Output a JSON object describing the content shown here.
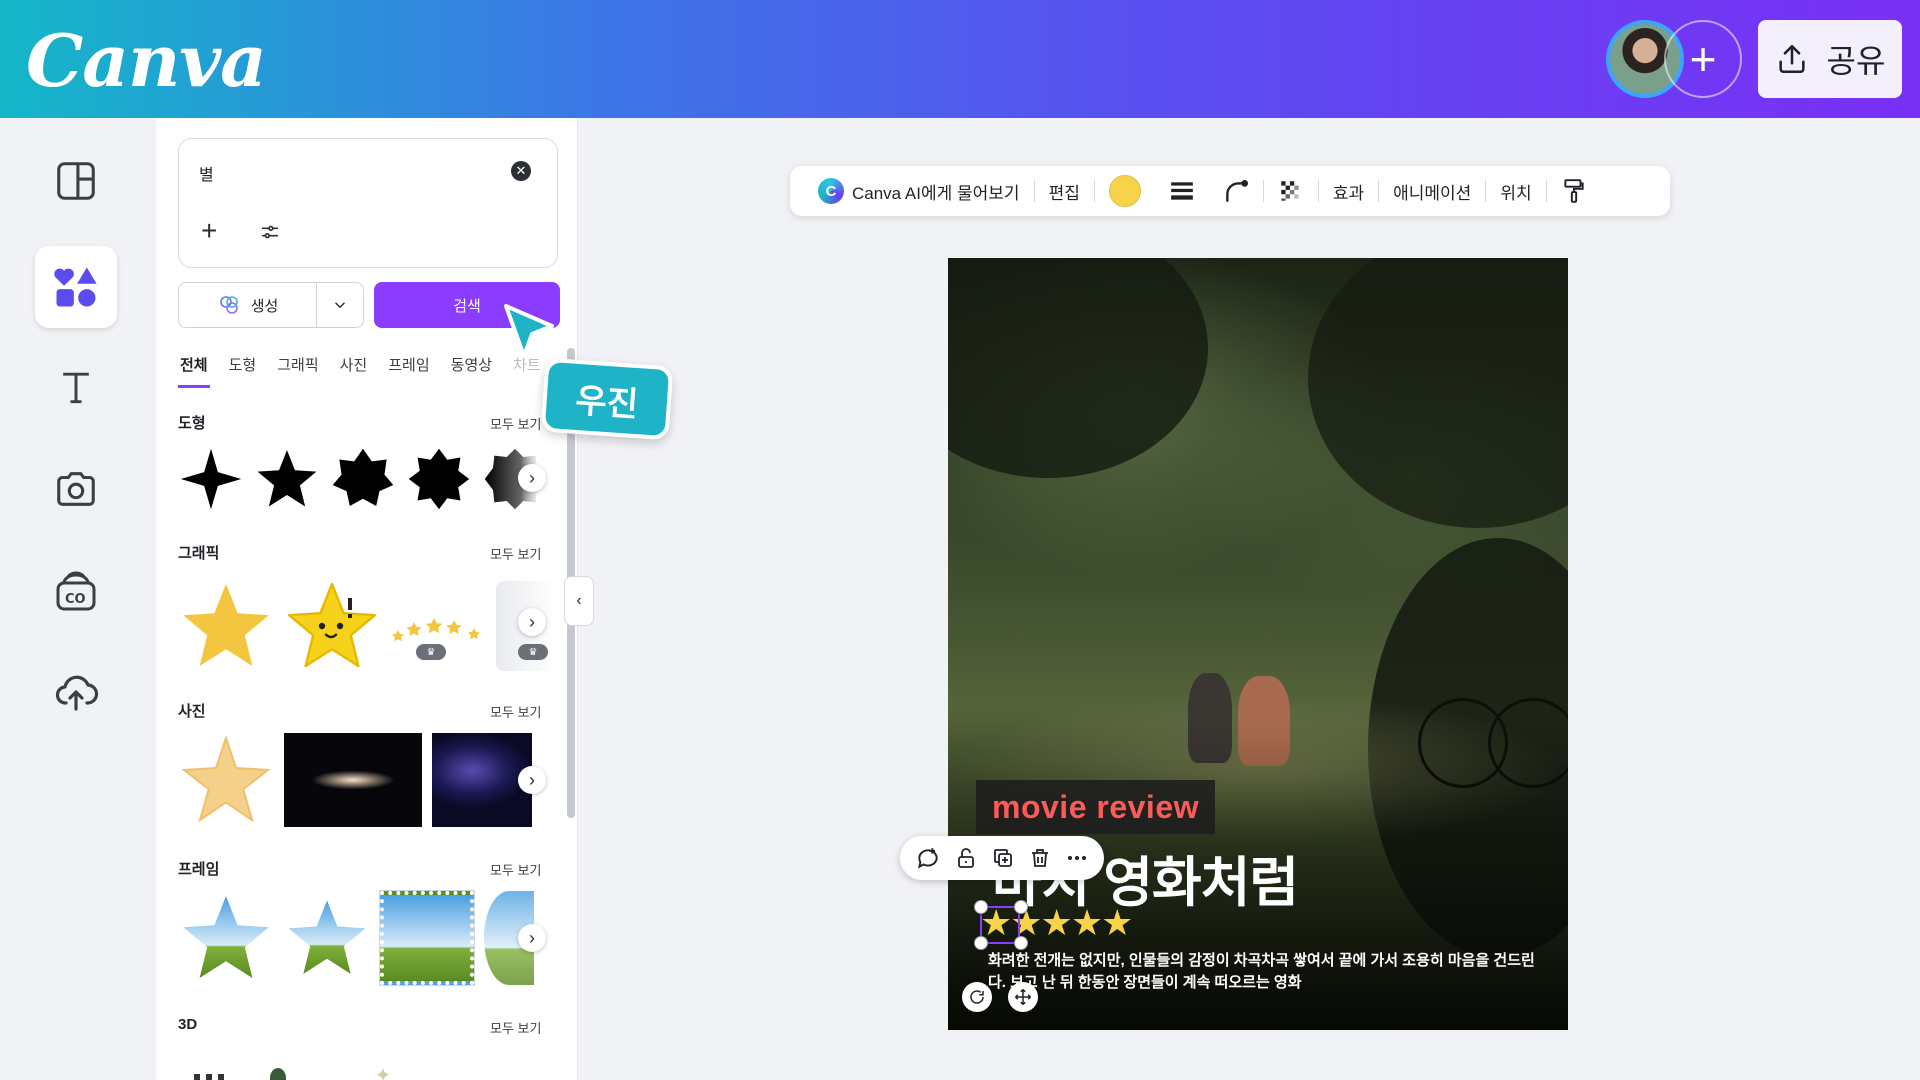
{
  "header": {
    "logo": "Canva",
    "share_label": "공유",
    "add_collaborator": "+"
  },
  "rail": {
    "items": [
      {
        "icon": "layout-icon",
        "active": false
      },
      {
        "icon": "elements-icon",
        "active": true
      },
      {
        "icon": "text-icon",
        "active": false
      },
      {
        "icon": "camera-icon",
        "active": false
      },
      {
        "icon": "brand-icon",
        "active": false
      },
      {
        "icon": "cloud-upload-icon",
        "active": false
      }
    ]
  },
  "panel": {
    "search_value": "별",
    "generate_label": "생성",
    "search_button": "검색",
    "tabs": [
      "전체",
      "도형",
      "그래픽",
      "사진",
      "프레임",
      "동영상",
      "차트"
    ],
    "see_all": "모두 보기",
    "sections": {
      "shapes": "도형",
      "graphics": "그래픽",
      "photos": "사진",
      "frames": "프레임",
      "three_d": "3D"
    }
  },
  "collaborator": {
    "name": "우진",
    "color": "#1fb3c7"
  },
  "toolbar": {
    "ai_label": "Canva AI에게 물어보기",
    "edit": "편집",
    "effects": "효과",
    "animation": "애니메이션",
    "position": "위치",
    "fill_color": "#f7d34a"
  },
  "design": {
    "badge": "movie review",
    "headline": "마치 영화처럼",
    "stars": "★★★★★",
    "description": "화려한 전개는 없지만, 인물들의 감정이 차곡차곡 쌓여서 끝에 가서 조용히 마음을 건드린다. 보고 난 뒤 한동안 장면들이 계속 떠오르는 영화"
  },
  "colors": {
    "accent": "#8b3dff",
    "star": "#f7d34a",
    "badge_text": "#ff5a5a"
  }
}
